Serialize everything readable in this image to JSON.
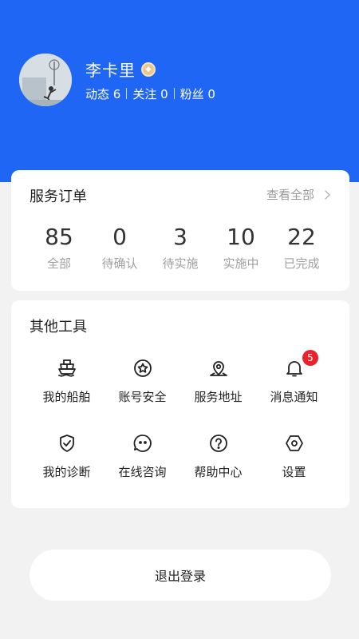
{
  "profile": {
    "username": "李卡里",
    "badge_icon": "medal-icon",
    "posts_label": "动态 6",
    "following_label": "关注 0",
    "followers_label": "粉丝 0"
  },
  "orders": {
    "title": "服务订单",
    "view_all": "查看全部",
    "stats": [
      {
        "value": "85",
        "label": "全部"
      },
      {
        "value": "0",
        "label": "待确认"
      },
      {
        "value": "3",
        "label": "待实施"
      },
      {
        "value": "10",
        "label": "实施中"
      },
      {
        "value": "22",
        "label": "已完成"
      }
    ]
  },
  "tools": {
    "title": "其他工具",
    "items": [
      {
        "label": "我的船舶",
        "icon": "ship-icon"
      },
      {
        "label": "账号安全",
        "icon": "shield-star-icon"
      },
      {
        "label": "服务地址",
        "icon": "map-pin-icon"
      },
      {
        "label": "消息通知",
        "icon": "bell-icon",
        "badge": "5"
      },
      {
        "label": "我的诊断",
        "icon": "shield-check-icon"
      },
      {
        "label": "在线咨询",
        "icon": "chat-face-icon"
      },
      {
        "label": "帮助中心",
        "icon": "help-circle-icon"
      },
      {
        "label": "设置",
        "icon": "settings-hexagon-icon"
      }
    ]
  },
  "logout": {
    "label": "退出登录"
  },
  "colors": {
    "header": "#1f66f5",
    "badge_red": "#e8232e",
    "background": "#f2f2f2"
  }
}
